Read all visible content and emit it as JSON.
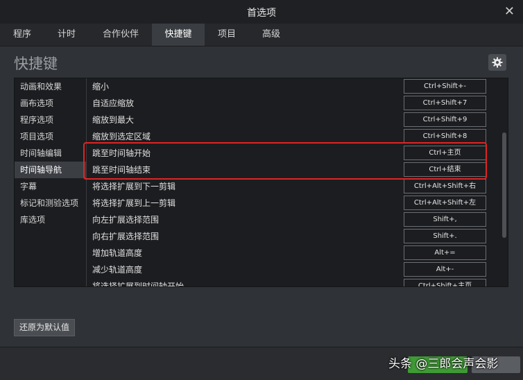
{
  "window": {
    "title": "首选项",
    "close_glyph": "✕"
  },
  "tabs": [
    {
      "label": "程序"
    },
    {
      "label": "计时"
    },
    {
      "label": "合作伙伴"
    },
    {
      "label": "快捷键"
    },
    {
      "label": "项目"
    },
    {
      "label": "高级"
    }
  ],
  "active_tab": "快捷键",
  "section_title": "快捷键",
  "categories": [
    {
      "label": "动画和效果"
    },
    {
      "label": "画布选项"
    },
    {
      "label": "程序选项"
    },
    {
      "label": "项目选项"
    },
    {
      "label": "时间轴编辑"
    },
    {
      "label": "时间轴导航"
    },
    {
      "label": "字幕"
    },
    {
      "label": "标记和测验选项"
    },
    {
      "label": "库选项"
    }
  ],
  "active_category": "时间轴导航",
  "commands": [
    {
      "name": "缩小",
      "key": "Ctrl+Shift+-"
    },
    {
      "name": "自适应缩放",
      "key": "Ctrl+Shift+7"
    },
    {
      "name": "缩放到最大",
      "key": "Ctrl+Shift+9"
    },
    {
      "name": "缩放到选定区域",
      "key": "Ctrl+Shift+8"
    },
    {
      "name": "跳至时间轴开始",
      "key": "Ctrl+主页"
    },
    {
      "name": "跳至时间轴结束",
      "key": "Ctrl+结束"
    },
    {
      "name": "将选择扩展到下一剪辑",
      "key": "Ctrl+Alt+Shift+右"
    },
    {
      "name": "将选择扩展到上一剪辑",
      "key": "Ctrl+Alt+Shift+左"
    },
    {
      "name": "向左扩展选择范围",
      "key": "Shift+,"
    },
    {
      "name": "向右扩展选择范围",
      "key": "Shift+."
    },
    {
      "name": "增加轨道高度",
      "key": "Alt+="
    },
    {
      "name": "减少轨道高度",
      "key": "Alt+-"
    },
    {
      "name": "将选择扩展到时间轴开始",
      "key": "Ctrl+Shift+主页"
    }
  ],
  "highlighted_commands": [
    "跳至时间轴开始",
    "跳至时间轴结束"
  ],
  "highlight_color": "#e02424",
  "buttons": {
    "reset": "还原为默认值"
  },
  "watermark": "头条 @三郎会声会影",
  "colors": {
    "ok_button": "#3f9b35",
    "background": "#2f3236"
  }
}
